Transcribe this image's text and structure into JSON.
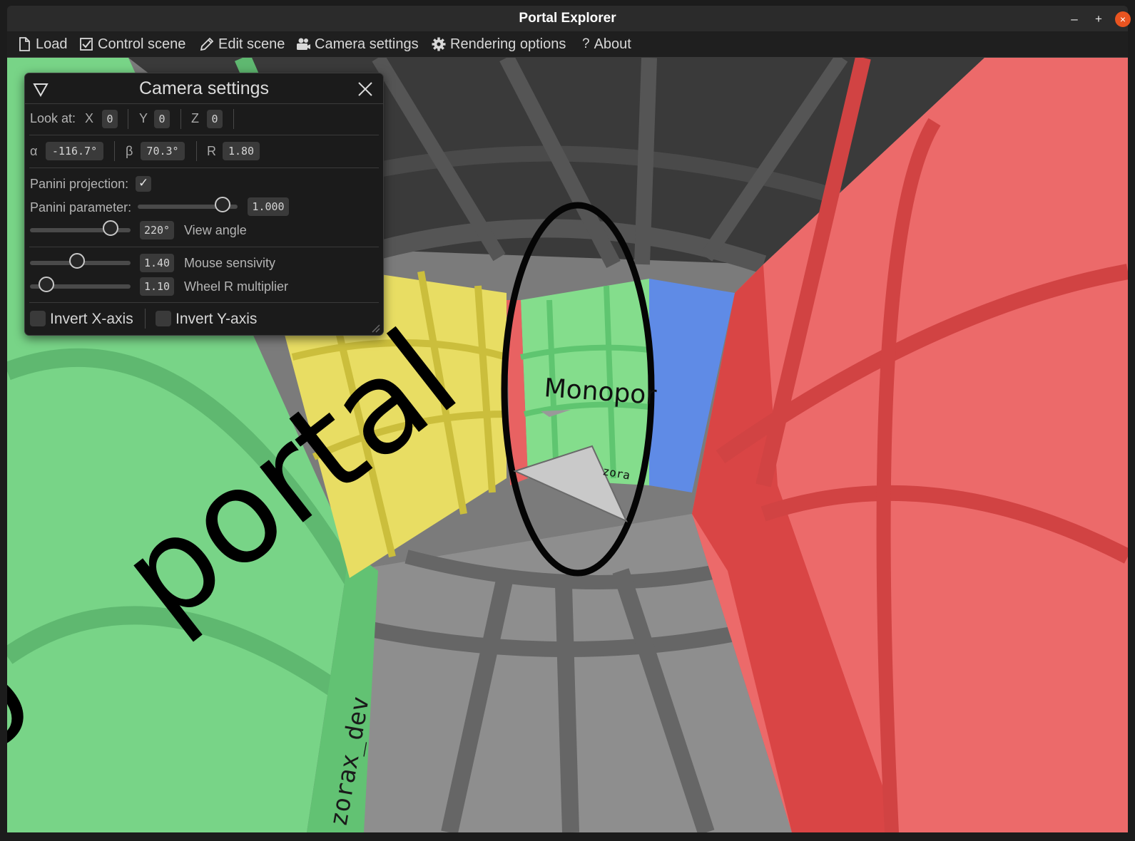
{
  "window": {
    "title": "Portal Explorer",
    "minimize_label": "–",
    "maximize_label": "+",
    "close_label": "×"
  },
  "menu": {
    "items": [
      {
        "label": "Load",
        "icon": "file-icon"
      },
      {
        "label": "Control scene",
        "icon": "checkbox-icon"
      },
      {
        "label": "Edit scene",
        "icon": "pencil-icon"
      },
      {
        "label": "Camera settings",
        "icon": "camera-icon"
      },
      {
        "label": "Rendering options",
        "icon": "gear-icon"
      },
      {
        "label": "About",
        "icon": "question-icon"
      }
    ],
    "about_glyph": "?"
  },
  "scene": {
    "left_wall_text": "portal",
    "left_wall_partial_glyph": "o",
    "side_text": "zorax_dev",
    "far_wall_text": "Monopor",
    "far_wall_small_text": "zora",
    "colors": {
      "green": "#7fd28a",
      "yellow": "#e6d95a",
      "red": "#e85858",
      "blue": "#5b86ea",
      "gray": "#7d7d7d"
    }
  },
  "camera_panel": {
    "title": "Camera settings",
    "look_at": {
      "label": "Look at:",
      "x_label": "X",
      "x_value": "0",
      "y_label": "Y",
      "y_value": "0",
      "z_label": "Z",
      "z_value": "0"
    },
    "angles": {
      "alpha_label": "α",
      "alpha_value": "-116.7°",
      "beta_label": "β",
      "beta_value": "70.3°",
      "r_label": "R",
      "r_value": "1.80"
    },
    "panini_projection": {
      "label": "Panini projection:",
      "checked": true,
      "check_glyph": "✓"
    },
    "panini_parameter": {
      "label": "Panini parameter:",
      "value": "1.000",
      "fraction": 0.85
    },
    "view_angle": {
      "label": "View angle",
      "value": "220°",
      "fraction": 0.8
    },
    "mouse_sensitivity": {
      "label": "Mouse sensivity",
      "value": "1.40",
      "fraction": 0.47
    },
    "wheel_r_multiplier": {
      "label": "Wheel R multiplier",
      "value": "1.10",
      "fraction": 0.16
    },
    "invert_x": {
      "label": "Invert X-axis",
      "checked": false
    },
    "invert_y": {
      "label": "Invert Y-axis",
      "checked": false
    }
  }
}
